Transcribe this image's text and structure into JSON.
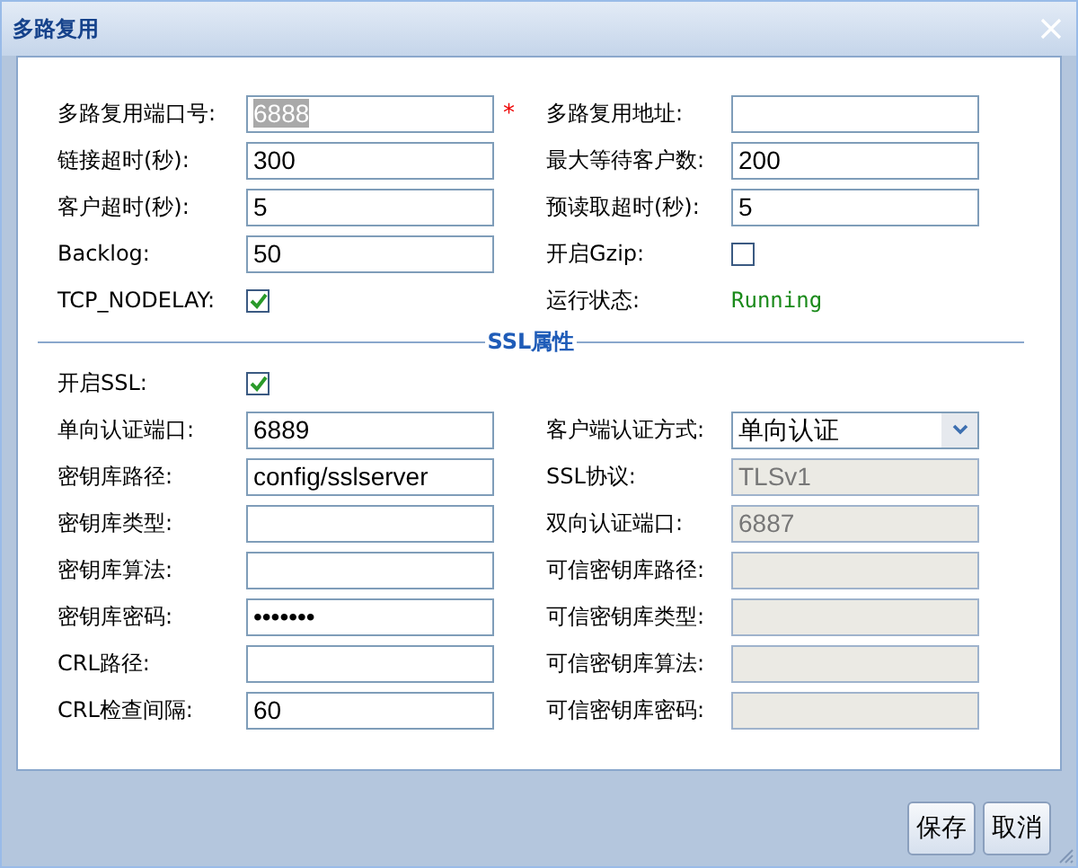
{
  "window": {
    "title": "多路复用"
  },
  "general": {
    "rows": [
      {
        "left": {
          "label": "多路复用端口号:",
          "kind": "text",
          "value": "6888",
          "text_selected": true,
          "required_mark": "*"
        },
        "right": {
          "label": "多路复用地址:",
          "kind": "text"
        }
      },
      {
        "left": {
          "label": "链接超时(秒):",
          "kind": "text",
          "value": "300"
        },
        "right": {
          "label": "最大等待客户数:",
          "kind": "text",
          "value": "200"
        }
      },
      {
        "left": {
          "label": "客户超时(秒):",
          "kind": "text",
          "value": "5"
        },
        "right": {
          "label": "预读取超时(秒):",
          "kind": "text",
          "value": "5"
        }
      },
      {
        "left": {
          "label": "Backlog:",
          "kind": "text",
          "value": "50"
        },
        "right": {
          "label": "开启Gzip:",
          "kind": "checkbox",
          "checked": false
        }
      },
      {
        "left": {
          "label": "TCP_NODELAY:",
          "kind": "checkbox",
          "checked": true
        },
        "right": {
          "label": "运行状态:",
          "kind": "status",
          "value": "Running"
        }
      }
    ]
  },
  "ssl": {
    "title": "SSL属性",
    "rows": [
      {
        "left": {
          "label": "开启SSL:",
          "kind": "checkbox",
          "checked": true
        }
      },
      {
        "left": {
          "label": "单向认证端口:",
          "kind": "text",
          "value": "6889"
        },
        "right": {
          "label": "客户端认证方式:",
          "kind": "select",
          "value": "单向认证"
        }
      },
      {
        "left": {
          "label": "密钥库路径:",
          "kind": "text",
          "value": "config/sslserver"
        },
        "right": {
          "label": "SSL协议:",
          "kind": "text",
          "value": "TLSv1",
          "disabled": true
        }
      },
      {
        "left": {
          "label": "密钥库类型:",
          "kind": "text"
        },
        "right": {
          "label": "双向认证端口:",
          "kind": "text",
          "value": "6887",
          "disabled": true
        }
      },
      {
        "left": {
          "label": "密钥库算法:",
          "kind": "text"
        },
        "right": {
          "label": "可信密钥库路径:",
          "kind": "text",
          "disabled": true
        }
      },
      {
        "left": {
          "label": "密钥库密码:",
          "kind": "password",
          "value": "•••••••"
        },
        "right": {
          "label": "可信密钥库类型:",
          "kind": "text",
          "disabled": true
        }
      },
      {
        "left": {
          "label": "CRL路径:",
          "kind": "text"
        },
        "right": {
          "label": "可信密钥库算法:",
          "kind": "text",
          "disabled": true
        }
      },
      {
        "left": {
          "label": "CRL检查间隔:",
          "kind": "text",
          "value": "60"
        },
        "right": {
          "label": "可信密钥库密码:",
          "kind": "text",
          "disabled": true
        }
      }
    ]
  },
  "buttons": [
    "保存",
    "取消"
  ]
}
